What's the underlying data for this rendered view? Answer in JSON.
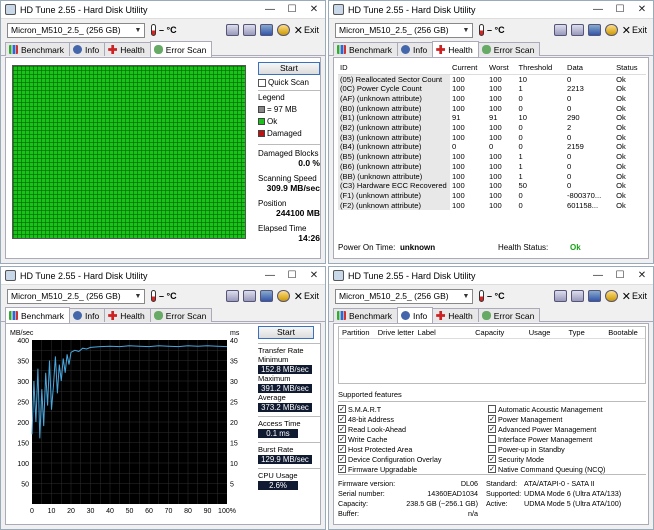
{
  "app": {
    "title": "HD Tune 2.55 - Hard Disk Utility",
    "drive": "Micron_M510_2.5_ (256 GB)",
    "temperature": "– °C",
    "exit_label": "Exit",
    "tabs": {
      "benchmark": "Benchmark",
      "info": "Info",
      "health": "Health",
      "error_scan": "Error Scan"
    }
  },
  "error_scan": {
    "start_label": "Start",
    "quick_scan_label": "Quick Scan",
    "legend_title": "Legend",
    "legend_block": "= 97 MB",
    "legend_ok": "Ok",
    "legend_damaged": "Damaged",
    "damaged_blocks_label": "Damaged Blocks",
    "damaged_blocks_value": "0.0 %",
    "scanning_speed_label": "Scanning Speed",
    "scanning_speed_value": "309.9 MB/sec",
    "position_label": "Position",
    "position_value": "244100 MB",
    "elapsed_label": "Elapsed Time",
    "elapsed_value": "14:26",
    "colors": {
      "ok": "#19c319",
      "damaged": "#c01010",
      "block": "#888888"
    }
  },
  "health": {
    "columns": [
      "ID",
      "Current",
      "Worst",
      "Threshold",
      "Data",
      "Status"
    ],
    "rows": [
      [
        "(05) Reallocated Sector Count",
        "100",
        "100",
        "10",
        "0",
        "Ok"
      ],
      [
        "(0C) Power Cycle Count",
        "100",
        "100",
        "1",
        "2213",
        "Ok"
      ],
      [
        "(AF) (unknown attribute)",
        "100",
        "100",
        "0",
        "0",
        "Ok"
      ],
      [
        "(B0) (unknown attribute)",
        "100",
        "100",
        "0",
        "0",
        "Ok"
      ],
      [
        "(B1) (unknown attribute)",
        "91",
        "91",
        "10",
        "290",
        "Ok"
      ],
      [
        "(B2) (unknown attribute)",
        "100",
        "100",
        "0",
        "2",
        "Ok"
      ],
      [
        "(B3) (unknown attribute)",
        "100",
        "100",
        "0",
        "0",
        "Ok"
      ],
      [
        "(B4) (unknown attribute)",
        "0",
        "0",
        "0",
        "2159",
        "Ok"
      ],
      [
        "(B5) (unknown attribute)",
        "100",
        "100",
        "1",
        "0",
        "Ok"
      ],
      [
        "(B6) (unknown attribute)",
        "100",
        "100",
        "1",
        "0",
        "Ok"
      ],
      [
        "(BB) (unknown attribute)",
        "100",
        "100",
        "1",
        "0",
        "Ok"
      ],
      [
        "(C3) Hardware ECC Recovered",
        "100",
        "100",
        "50",
        "0",
        "Ok"
      ],
      [
        "(F1) (unknown attribute)",
        "100",
        "100",
        "0",
        "-800370...",
        "Ok"
      ],
      [
        "(F2) (unknown attribute)",
        "100",
        "100",
        "0",
        "601158...",
        "Ok"
      ]
    ],
    "power_on_label": "Power On Time:",
    "power_on_value": "unknown",
    "status_label": "Health Status:",
    "status_value": "Ok",
    "status_color": "#18a018"
  },
  "benchmark": {
    "start_label": "Start",
    "transfer_rate_label": "Transfer Rate",
    "minimum_label": "Minimum",
    "minimum_value": "152.8 MB/sec",
    "maximum_label": "Maximum",
    "maximum_value": "391.2 MB/sec",
    "average_label": "Average",
    "average_value": "373.2 MB/sec",
    "access_time_label": "Access Time",
    "access_time_value": "0.1 ms",
    "burst_rate_label": "Burst Rate",
    "burst_rate_value": "129.9 MB/sec",
    "cpu_usage_label": "CPU Usage",
    "cpu_usage_value": "2.6%"
  },
  "chart_data": {
    "type": "line",
    "left_axis_label": "MB/sec",
    "right_axis_label": "ms",
    "y_ticks": [
      "400",
      "350",
      "300",
      "250",
      "200",
      "150",
      "100",
      "50"
    ],
    "y2_ticks": [
      "40",
      "35",
      "30",
      "25",
      "20",
      "15",
      "10",
      "5"
    ],
    "x_ticks": [
      "0",
      "10",
      "20",
      "30",
      "40",
      "50",
      "60",
      "70",
      "80",
      "90",
      "100%"
    ],
    "ylim": [
      0,
      400
    ],
    "y2lim": [
      0,
      40
    ],
    "xlim": [
      0,
      100
    ],
    "grid": true,
    "colors": {
      "background": "#000000",
      "grid": "#2e2e2e",
      "line": "#4aa8e0"
    },
    "x": [
      0,
      1,
      2,
      3,
      4,
      5,
      6,
      7,
      8,
      9,
      10,
      11,
      12,
      13,
      14,
      15,
      16,
      17,
      18,
      19,
      20,
      22,
      24,
      26,
      28,
      30,
      35,
      40,
      45,
      50,
      55,
      60,
      65,
      70,
      75,
      80,
      85,
      90,
      95,
      100
    ],
    "y": [
      170,
      300,
      200,
      330,
      160,
      280,
      190,
      320,
      240,
      350,
      230,
      290,
      360,
      270,
      340,
      300,
      355,
      320,
      365,
      340,
      370,
      375,
      372,
      380,
      378,
      382,
      384,
      385,
      384,
      386,
      385,
      384,
      386,
      385,
      384,
      386,
      385,
      386,
      385,
      384
    ]
  },
  "info": {
    "partition_columns": [
      "Partition",
      "Drive letter",
      "Label",
      "Capacity",
      "Usage",
      "Type",
      "Bootable"
    ],
    "supported_features_label": "Supported features",
    "features_left": [
      {
        "label": "S.M.A.R.T",
        "checked": true
      },
      {
        "label": "48-bit Address",
        "checked": true
      },
      {
        "label": "Read Look-Ahead",
        "checked": true
      },
      {
        "label": "Write Cache",
        "checked": true
      },
      {
        "label": "Host Protected Area",
        "checked": true
      },
      {
        "label": "Device Configuration Overlay",
        "checked": true
      },
      {
        "label": "Firmware Upgradable",
        "checked": true
      }
    ],
    "features_right": [
      {
        "label": "Automatic Acoustic Management",
        "checked": false
      },
      {
        "label": "Power Management",
        "checked": true
      },
      {
        "label": "Advanced Power Management",
        "checked": true
      },
      {
        "label": "Interface Power Management",
        "checked": false
      },
      {
        "label": "Power-up in Standby",
        "checked": false
      },
      {
        "label": "Security Mode",
        "checked": true
      },
      {
        "label": "Native Command Queuing (NCQ)",
        "checked": true
      }
    ],
    "firmware_label": "Firmware version:",
    "firmware_value": "DL06",
    "serial_label": "Serial number:",
    "serial_value": "14360EAD1034",
    "capacity_label": "Capacity:",
    "capacity_value": "238.5 GB (~256.1 GB)",
    "buffer_label": "Buffer:",
    "buffer_value": "n/a",
    "standard_label": "Standard:",
    "standard_value": "ATA/ATAPI-0 - SATA II",
    "supported_label": "Supported:",
    "supported_value": "UDMA Mode 6 (Ultra ATA/133)",
    "active_label": "Active:",
    "active_value": "UDMA Mode 5 (Ultra ATA/100)"
  }
}
